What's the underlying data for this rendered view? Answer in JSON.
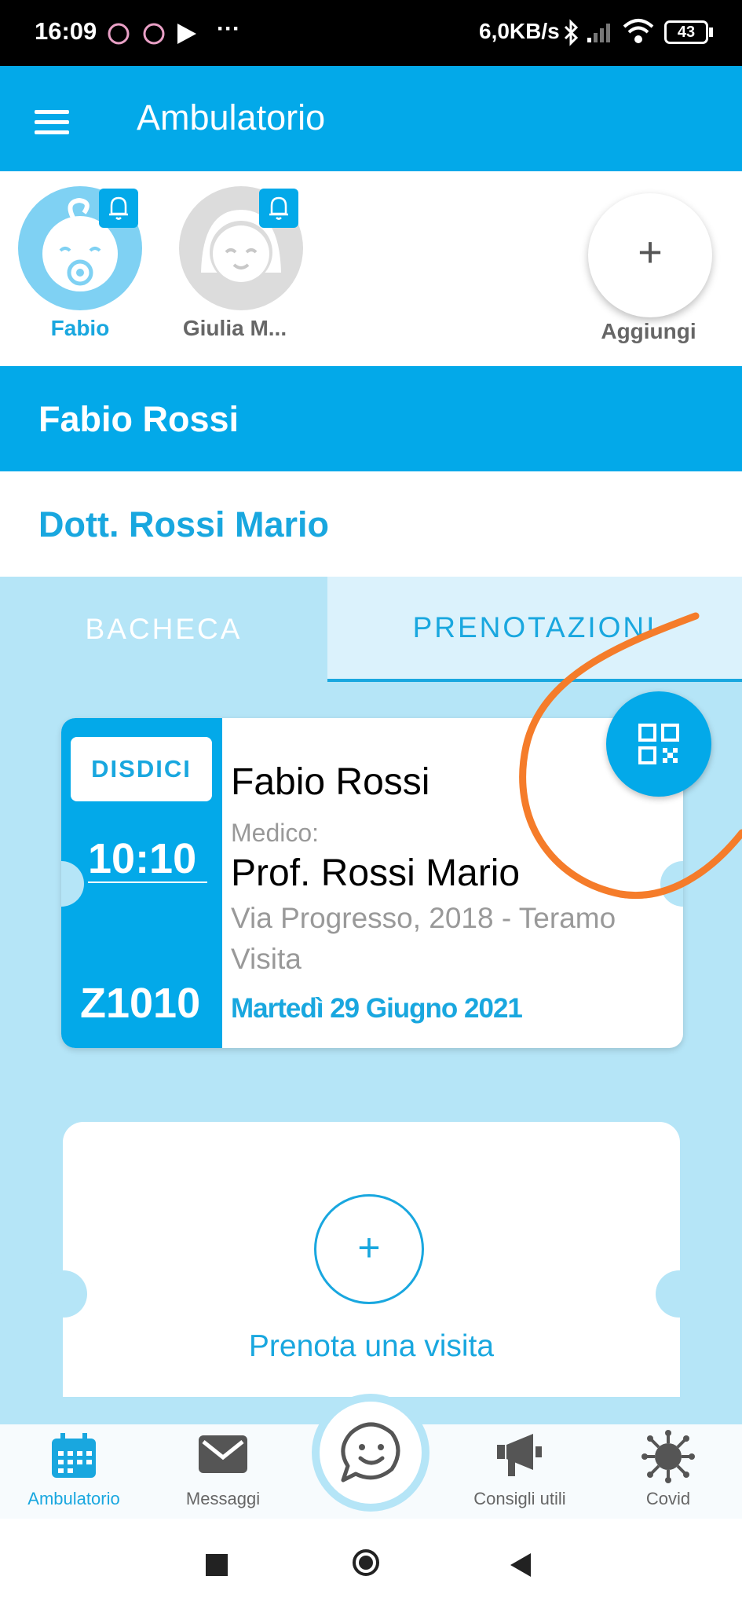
{
  "status_bar": {
    "time": "16:09",
    "overflow": "···",
    "net_speed": "6,0KB/s",
    "battery": "43"
  },
  "app_bar": {
    "title": "Ambulatorio",
    "menu_icon": "hamburger-icon"
  },
  "profiles": [
    {
      "name": "Fabio",
      "selected": true
    },
    {
      "name": "Giulia M...",
      "selected": false
    }
  ],
  "add_profile": {
    "symbol": "+",
    "label": "Aggiungi"
  },
  "patient": {
    "name": "Fabio Rossi"
  },
  "doctor": {
    "name": "Dott. Rossi Mario"
  },
  "tabs": [
    {
      "label": "BACHECA",
      "active": false
    },
    {
      "label": "PRENOTAZIONI",
      "active": true
    }
  ],
  "appointment": {
    "cancel_label": "DISDICI",
    "time": "10:10",
    "code": "Z1010",
    "patient": "Fabio Rossi",
    "doctor_label": "Medico:",
    "doctor": "Prof. Rossi Mario",
    "address": "Via Progresso, 2018 - Teramo",
    "type": "Visita",
    "date": "Martedì 29 Giugno 2021"
  },
  "booking": {
    "symbol": "+",
    "label": "Prenota una visita"
  },
  "bottom_nav": [
    {
      "label": "Ambulatorio",
      "icon": "calendar-icon",
      "active": true
    },
    {
      "label": "Messaggi",
      "icon": "envelope-icon",
      "active": false
    },
    {
      "label": "Consigli utili",
      "icon": "megaphone-icon",
      "active": false
    },
    {
      "label": "Covid",
      "icon": "virus-icon",
      "active": false
    }
  ],
  "colors": {
    "primary": "#03a9e9",
    "background": "#b5e5f7",
    "annotation": "#f57c2a"
  }
}
